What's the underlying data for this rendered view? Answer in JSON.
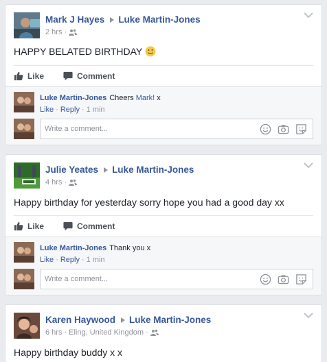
{
  "posts": [
    {
      "author": "Mark J Hayes",
      "target": "Luke Martin-Jones",
      "time": "2 hrs",
      "location": "",
      "text": "HAPPY BELATED BIRTHDAY",
      "has_emoji": true,
      "like_label": "Like",
      "comment_label": "Comment",
      "reply": {
        "author": "Luke Martin-Jones",
        "text_before": "Cheers",
        "mention": "Mark!",
        "text_after": "x",
        "like_label": "Like",
        "reply_label": "Reply",
        "time": "1 min"
      },
      "input_placeholder": "Write a comment..."
    },
    {
      "author": "Julie Yeates",
      "target": "Luke Martin-Jones",
      "time": "4 hrs",
      "location": "",
      "text": "Happy birthday for yesterday sorry hope you had a good day xx",
      "like_label": "Like",
      "comment_label": "Comment",
      "reply": {
        "author": "Luke Martin-Jones",
        "text_before": "Thank you x",
        "mention": "",
        "text_after": "",
        "like_label": "Like",
        "reply_label": "Reply",
        "time": "1 min"
      },
      "input_placeholder": "Write a comment..."
    },
    {
      "author": "Karen Haywood",
      "target": "Luke Martin-Jones",
      "time": "6 hrs",
      "location": "Eling, United Kingdom",
      "text": "Happy birthday buddy x x"
    }
  ],
  "meta_separator": "·",
  "colors": {
    "link": "#365899",
    "muted": "#90949c",
    "bg": "#e9ebee"
  },
  "icons": [
    "friends-icon",
    "like-icon",
    "comment-icon",
    "emoji-icon",
    "camera-icon",
    "sticker-icon",
    "chevron-down-icon"
  ]
}
